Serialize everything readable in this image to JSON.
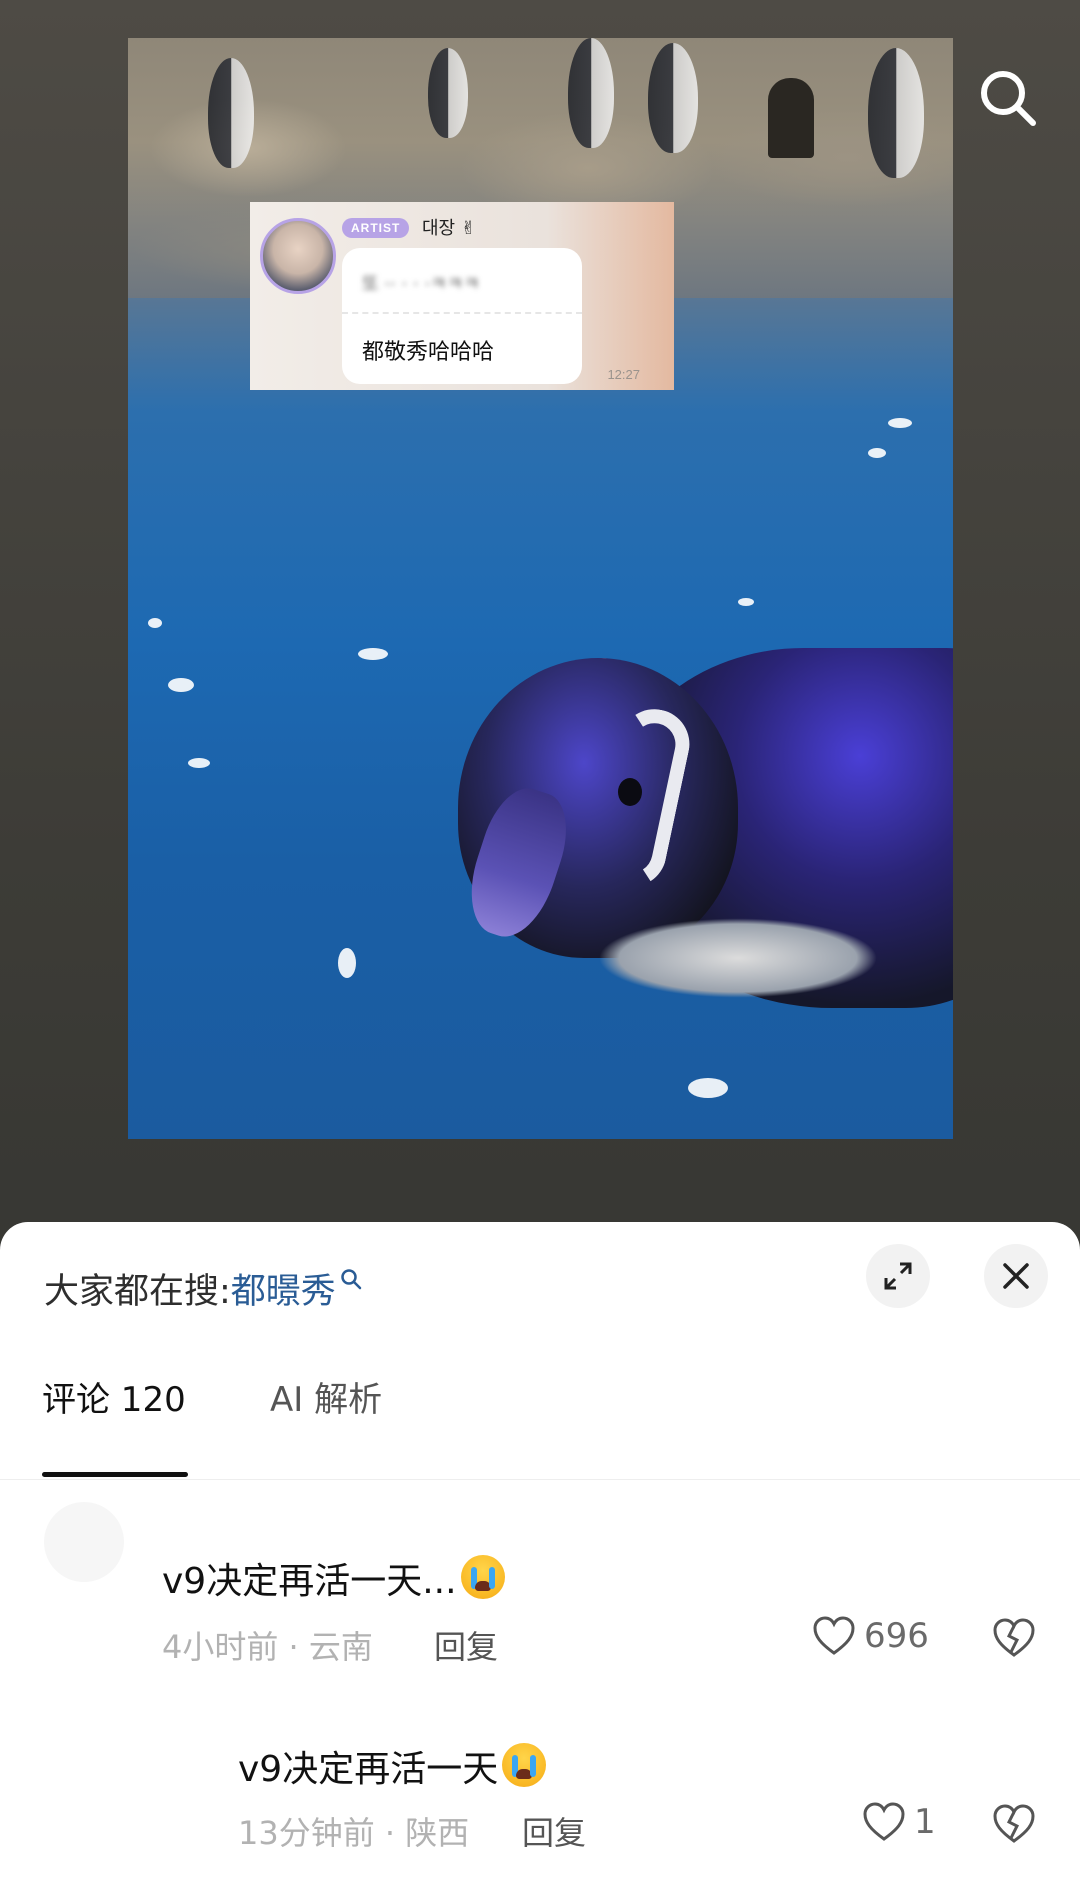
{
  "photo": {
    "chat_card": {
      "badge": "ARTIST",
      "name": "대장 ✌",
      "blurred_line": "또 ·· · · ·ㅋㅋㅋ",
      "message": "都敬秀哈哈哈",
      "time": "12:27"
    }
  },
  "header": {
    "search_icon": "search-icon"
  },
  "sheet": {
    "search_hint": {
      "prefix": "大家都在搜: ",
      "term": "都暻秀"
    },
    "buttons": {
      "expand_icon": "expand-icon",
      "close_icon": "close-icon"
    },
    "tabs": [
      {
        "label": "评论 120",
        "active": true
      },
      {
        "label": "AI 解析",
        "active": false
      }
    ],
    "comments": [
      {
        "text": "v9决定再活一天...",
        "emoji": "loudly-crying-face",
        "time_location": "4小时前 · 云南",
        "reply": "回复",
        "likes": "696"
      },
      {
        "text": "v9决定再活一天",
        "emoji": "loudly-crying-face",
        "time_location": "13分钟前 · 陕西",
        "reply": "回复",
        "likes": "1"
      }
    ]
  },
  "colors": {
    "search_term": "#2a5c95",
    "tab_active": "#111111",
    "meta_gray": "#b2b2b2",
    "avatar_ring": "#b7a3e6"
  }
}
